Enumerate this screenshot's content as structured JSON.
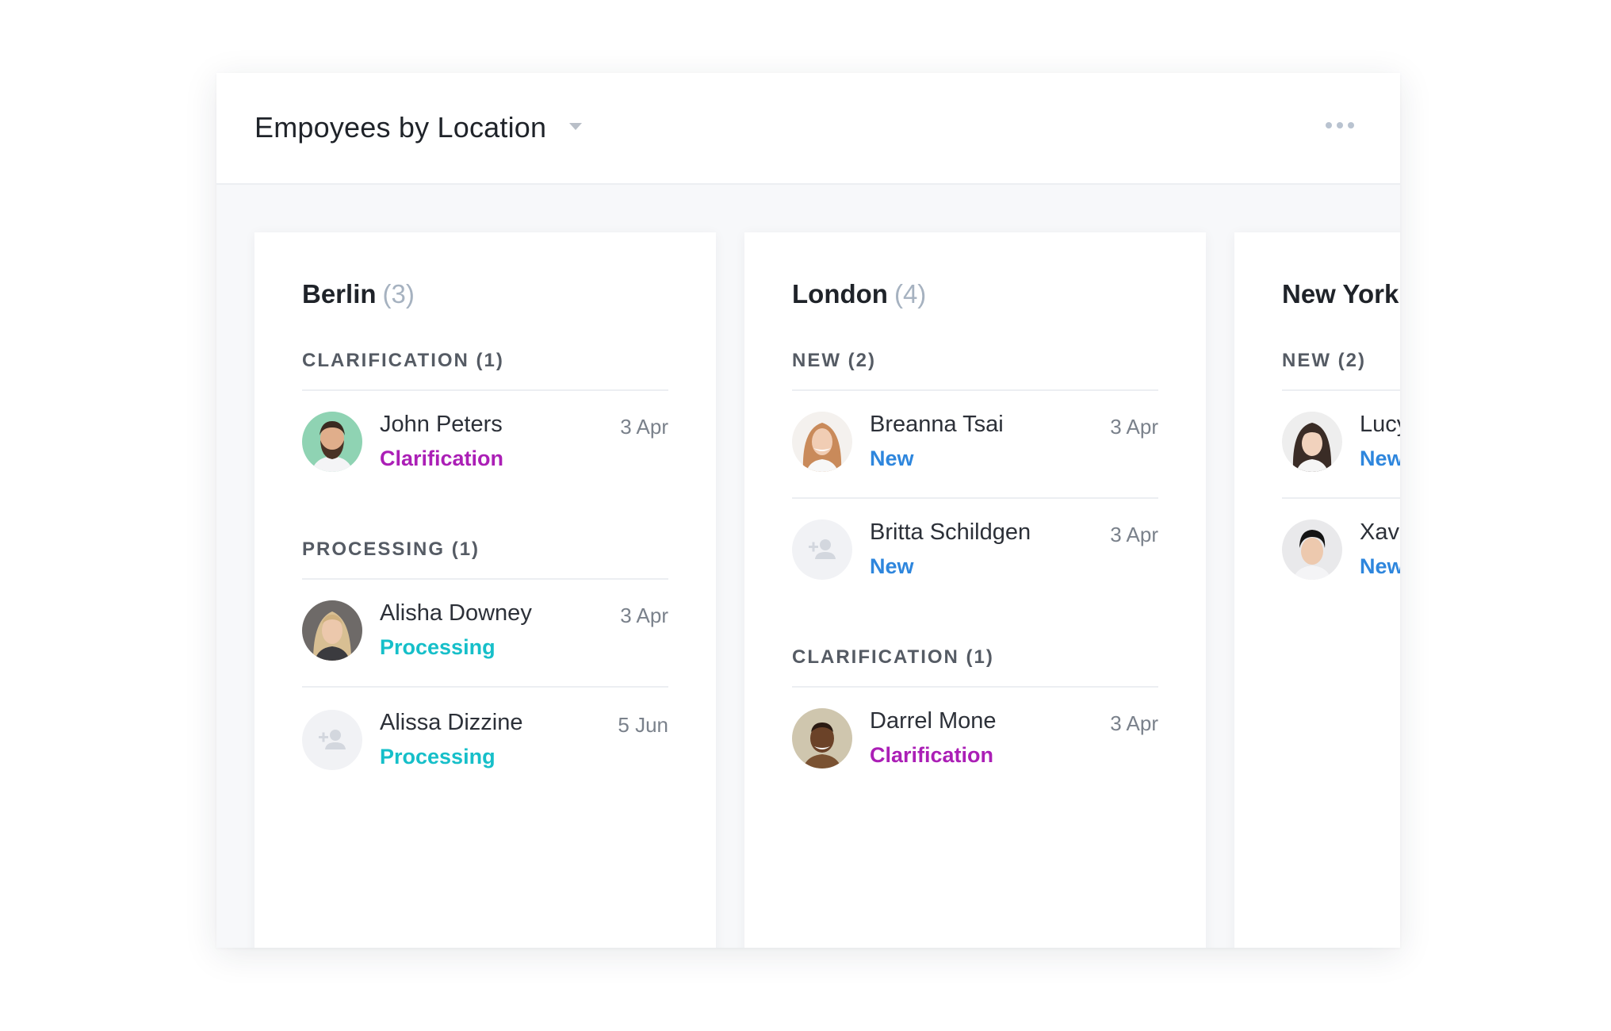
{
  "header": {
    "title": "Empoyees by Location",
    "dropdown_icon": "chevron-down-icon",
    "more_icon": "more-horizontal-icon"
  },
  "colors": {
    "clarification": "#ab1fb6",
    "processing": "#16bfc9",
    "new": "#2e86dd",
    "muted_count": "#a6b2c0"
  },
  "columns": [
    {
      "city": "Berlin",
      "count": "(3)",
      "groups": [
        {
          "label": "CLARIFICATION (1)",
          "items": [
            {
              "name": "John Peters",
              "status": "Clarification",
              "date": "3 Apr",
              "avatar": "photo-bearded-man"
            }
          ]
        },
        {
          "label": "PROCESSING (1)",
          "items": [
            {
              "name": "Alisha Downey",
              "status": "Processing",
              "date": "3 Apr",
              "avatar": "photo-blonde-woman"
            },
            {
              "name": "Alissa Dizzine",
              "status": "Processing",
              "date": "5 Jun",
              "avatar": "add-user-icon"
            }
          ]
        }
      ]
    },
    {
      "city": "London",
      "count": "(4)",
      "groups": [
        {
          "label": "NEW (2)",
          "items": [
            {
              "name": "Breanna Tsai",
              "status": "New",
              "date": "3 Apr",
              "avatar": "photo-redhead-woman"
            },
            {
              "name": "Britta Schildgen",
              "status": "New",
              "date": "3 Apr",
              "avatar": "add-user-icon"
            }
          ]
        },
        {
          "label": "CLARIFICATION (1)",
          "items": [
            {
              "name": "Darrel Mone",
              "status": "Clarification",
              "date": "3 Apr",
              "avatar": "photo-man-dark-skin"
            }
          ]
        }
      ]
    },
    {
      "city": "New York",
      "count": "",
      "groups": [
        {
          "label": "NEW (2)",
          "items": [
            {
              "name": "Lucy",
              "status": "New",
              "date": "",
              "avatar": "photo-asian-woman"
            },
            {
              "name": "Xavi",
              "status": "New",
              "date": "",
              "avatar": "photo-asian-man"
            }
          ]
        }
      ]
    }
  ]
}
